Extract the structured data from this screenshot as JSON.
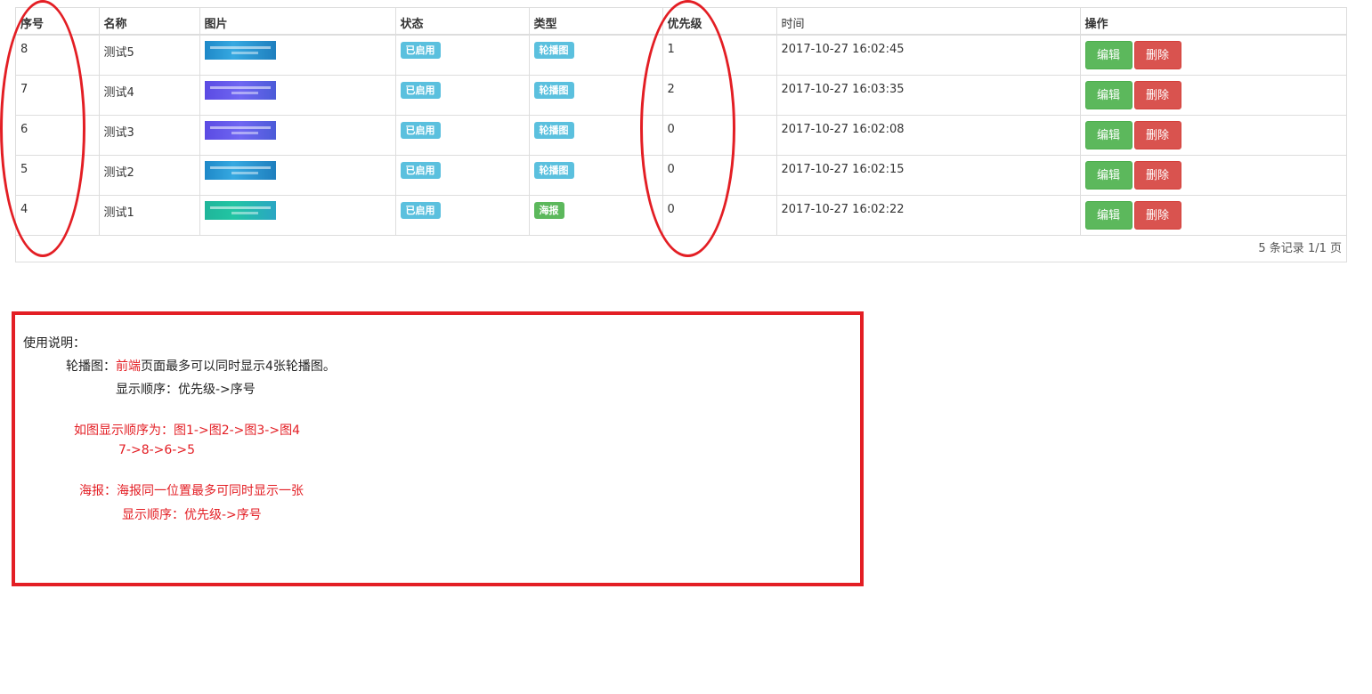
{
  "table": {
    "headers": [
      "序号",
      "名称",
      "图片",
      "状态",
      "类型",
      "优先级",
      "时间",
      "操作"
    ],
    "rows": [
      {
        "id": "8",
        "name": "测试5",
        "image": "blue",
        "status": "已启用",
        "type": "轮播图",
        "type_style": "info",
        "priority": "1",
        "time": "2017-10-27 16:02:45"
      },
      {
        "id": "7",
        "name": "测试4",
        "image": "purple",
        "status": "已启用",
        "type": "轮播图",
        "type_style": "info",
        "priority": "2",
        "time": "2017-10-27 16:03:35"
      },
      {
        "id": "6",
        "name": "测试3",
        "image": "purple",
        "status": "已启用",
        "type": "轮播图",
        "type_style": "info",
        "priority": "0",
        "time": "2017-10-27 16:02:08"
      },
      {
        "id": "5",
        "name": "测试2",
        "image": "blue",
        "status": "已启用",
        "type": "轮播图",
        "type_style": "info",
        "priority": "0",
        "time": "2017-10-27 16:02:15"
      },
      {
        "id": "4",
        "name": "测试1",
        "image": "green",
        "status": "已启用",
        "type": "海报",
        "type_style": "success",
        "priority": "0",
        "time": "2017-10-27 16:02:22"
      }
    ],
    "edit_label": "编辑",
    "delete_label": "删除",
    "footer": "5 条记录 1/1 页"
  },
  "notes": {
    "title": "使用说明：",
    "carousel_prefix": "轮播图：",
    "carousel_highlight": "前端",
    "carousel_rest": "页面最多可以同时显示4张轮播图。",
    "carousel_order": "显示顺序：优先级->序号",
    "example_line1": "如图显示顺序为：图1->图2->图3->图4",
    "example_line2": "7->8->6->5",
    "poster_line": "海报：海报同一位置最多可同时显示一张",
    "poster_order": "显示顺序：优先级->序号"
  },
  "colors": {
    "annotation_red": "#e31e24",
    "label_info": "#5bc0de",
    "label_success": "#5cb85c",
    "btn_edit": "#5cb85c",
    "btn_delete": "#d9534f"
  }
}
